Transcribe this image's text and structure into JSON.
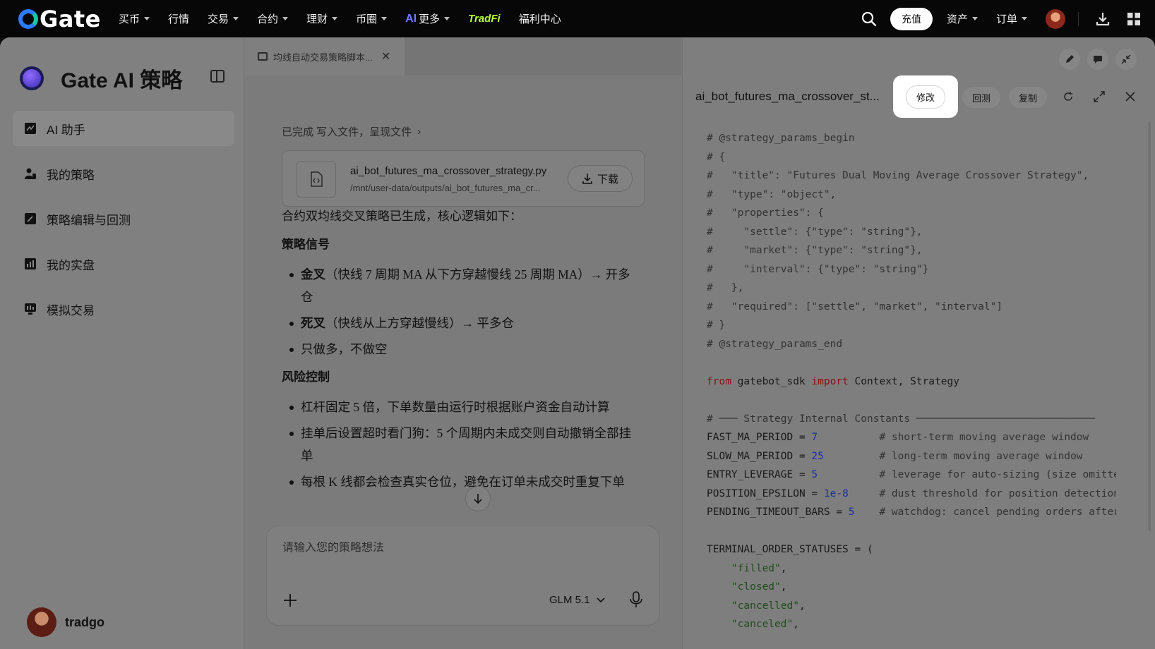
{
  "topnav": {
    "logo_text": "Gate",
    "items": [
      {
        "label": "买币",
        "caret": true
      },
      {
        "label": "行情",
        "caret": false
      },
      {
        "label": "交易",
        "caret": true
      },
      {
        "label": "合约",
        "caret": true
      },
      {
        "label": "理财",
        "caret": true
      },
      {
        "label": "币圈",
        "caret": true
      }
    ],
    "ai_badge": "AI",
    "more_label": "更多",
    "tradfi_label": "TradFi",
    "rewards_label": "福利中心",
    "deposit_label": "充值",
    "assets_label": "资产",
    "orders_label": "订单"
  },
  "sidebar": {
    "title": "Gate AI 策略",
    "items": [
      {
        "label": "AI 助手",
        "icon": "ai-assistant-icon",
        "active": true
      },
      {
        "label": "我的策略",
        "icon": "my-strategy-icon",
        "active": false
      },
      {
        "label": "策略编辑与回测",
        "icon": "strategy-edit-icon",
        "active": false
      },
      {
        "label": "我的实盘",
        "icon": "live-trading-icon",
        "active": false
      },
      {
        "label": "模拟交易",
        "icon": "simulated-trading-icon",
        "active": false
      }
    ],
    "username": "tradgo"
  },
  "chat": {
    "tab_label": "均线自动交易策略脚本...",
    "status_text": "已完成 写入文件，呈现文件",
    "file": {
      "name": "ai_bot_futures_ma_crossover_strategy.py",
      "path": "/mnt/user-data/outputs/ai_bot_futures_ma_cr...",
      "download_label": "下载"
    },
    "intro": "合约双均线交叉策略已生成，核心逻辑如下：",
    "section1_title": "策略信号",
    "signals": [
      {
        "bold": "金叉",
        "text": "（快线 7 周期 MA 从下方穿越慢线 25 周期 MA）→ 开多仓"
      },
      {
        "bold": "死叉",
        "text": "（快线从上方穿越慢线）→ 平多仓"
      },
      {
        "bold": "",
        "text": "只做多，不做空"
      }
    ],
    "section2_title": "风险控制",
    "risks": [
      "杠杆固定 5 倍，下单数量由运行时根据账户资金自动计算",
      "挂单后设置超时看门狗：5 个周期内未成交则自动撤销全部挂单",
      "每根 K 线都会检查真实仓位，避免在订单未成交时重复下单"
    ],
    "composer_placeholder": "请输入您的策略想法",
    "model_label": "GLM 5.1"
  },
  "code_panel": {
    "title": "ai_bot_futures_ma_crossover_st...",
    "edit_label": "修改",
    "backtest_label": "回测",
    "copy_label": "复制",
    "lines": [
      [
        {
          "t": "# @strategy_params_begin",
          "c": "cm"
        }
      ],
      [
        {
          "t": "# {",
          "c": "cm"
        }
      ],
      [
        {
          "t": "#   \"title\": \"Futures Dual Moving Average Crossover Strategy\",",
          "c": "cm"
        }
      ],
      [
        {
          "t": "#   \"type\": \"object\",",
          "c": "cm"
        }
      ],
      [
        {
          "t": "#   \"properties\": {",
          "c": "cm"
        }
      ],
      [
        {
          "t": "#     \"settle\": {\"type\": \"string\"},",
          "c": "cm"
        }
      ],
      [
        {
          "t": "#     \"market\": {\"type\": \"string\"},",
          "c": "cm"
        }
      ],
      [
        {
          "t": "#     \"interval\": {\"type\": \"string\"}",
          "c": "cm"
        }
      ],
      [
        {
          "t": "#   },",
          "c": "cm"
        }
      ],
      [
        {
          "t": "#   \"required\": [\"settle\", \"market\", \"interval\"]",
          "c": "cm"
        }
      ],
      [
        {
          "t": "# }",
          "c": "cm"
        }
      ],
      [
        {
          "t": "# @strategy_params_end",
          "c": "cm"
        }
      ],
      [
        {
          "t": "",
          "c": ""
        }
      ],
      [
        {
          "t": "from",
          "c": "kw"
        },
        {
          "t": " gatebot_sdk ",
          "c": ""
        },
        {
          "t": "import",
          "c": "kw"
        },
        {
          "t": " Context, Strategy",
          "c": ""
        }
      ],
      [
        {
          "t": "",
          "c": ""
        }
      ],
      [
        {
          "t": "# ─── Strategy Internal Constants ─────────────────────────────",
          "c": "cm"
        }
      ],
      [
        {
          "t": "FAST_MA_PERIOD = ",
          "c": ""
        },
        {
          "t": "7",
          "c": "num"
        },
        {
          "t": "          # short-term moving average window",
          "c": "cm"
        }
      ],
      [
        {
          "t": "SLOW_MA_PERIOD = ",
          "c": ""
        },
        {
          "t": "25",
          "c": "num"
        },
        {
          "t": "         # long-term moving average window",
          "c": "cm"
        }
      ],
      [
        {
          "t": "ENTRY_LEVERAGE = ",
          "c": ""
        },
        {
          "t": "5",
          "c": "num"
        },
        {
          "t": "          # leverage for auto-sizing (size omitted)",
          "c": "cm"
        }
      ],
      [
        {
          "t": "POSITION_EPSILON = ",
          "c": ""
        },
        {
          "t": "1e-8",
          "c": "num"
        },
        {
          "t": "     # dust threshold for position detection",
          "c": "cm"
        }
      ],
      [
        {
          "t": "PENDING_TIMEOUT_BARS = ",
          "c": ""
        },
        {
          "t": "5",
          "c": "num"
        },
        {
          "t": "    # watchdog: cancel pending orders after N",
          "c": "cm"
        }
      ],
      [
        {
          "t": "",
          "c": ""
        }
      ],
      [
        {
          "t": "TERMINAL_ORDER_STATUSES = (",
          "c": ""
        }
      ],
      [
        {
          "t": "    ",
          "c": ""
        },
        {
          "t": "\"filled\"",
          "c": "str"
        },
        {
          "t": ",",
          "c": ""
        }
      ],
      [
        {
          "t": "    ",
          "c": ""
        },
        {
          "t": "\"closed\"",
          "c": "str"
        },
        {
          "t": ",",
          "c": ""
        }
      ],
      [
        {
          "t": "    ",
          "c": ""
        },
        {
          "t": "\"cancelled\"",
          "c": "str"
        },
        {
          "t": ",",
          "c": ""
        }
      ],
      [
        {
          "t": "    ",
          "c": ""
        },
        {
          "t": "\"canceled\"",
          "c": "str"
        },
        {
          "t": ",",
          "c": ""
        }
      ]
    ]
  }
}
